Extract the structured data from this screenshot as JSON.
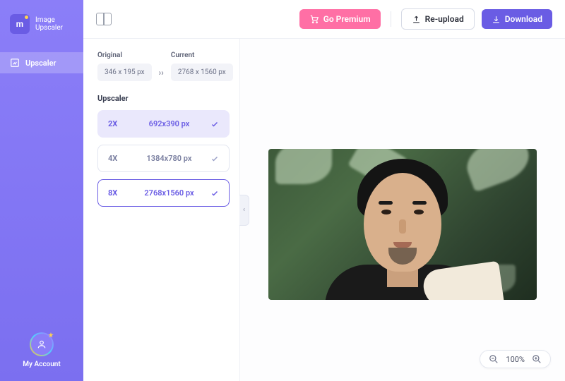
{
  "brand": {
    "name": "Image\nUpscaler",
    "logo_letter": "m"
  },
  "sidebar": {
    "nav": [
      {
        "label": "Upscaler"
      }
    ],
    "account_label": "My Account"
  },
  "topbar": {
    "premium_label": "Go Premium",
    "reupload_label": "Re-upload",
    "download_label": "Download"
  },
  "panel": {
    "original_label": "Original",
    "original_dim": "346 x 195 px",
    "current_label": "Current",
    "current_dim": "2768 x 1560 px",
    "section_title": "Upscaler",
    "options": [
      {
        "mult": "2X",
        "dim": "692x390 px",
        "state": "completed"
      },
      {
        "mult": "4X",
        "dim": "1384x780 px",
        "state": "done"
      },
      {
        "mult": "8X",
        "dim": "2768x1560 px",
        "state": "selected"
      }
    ]
  },
  "zoom": {
    "level": "100%"
  }
}
